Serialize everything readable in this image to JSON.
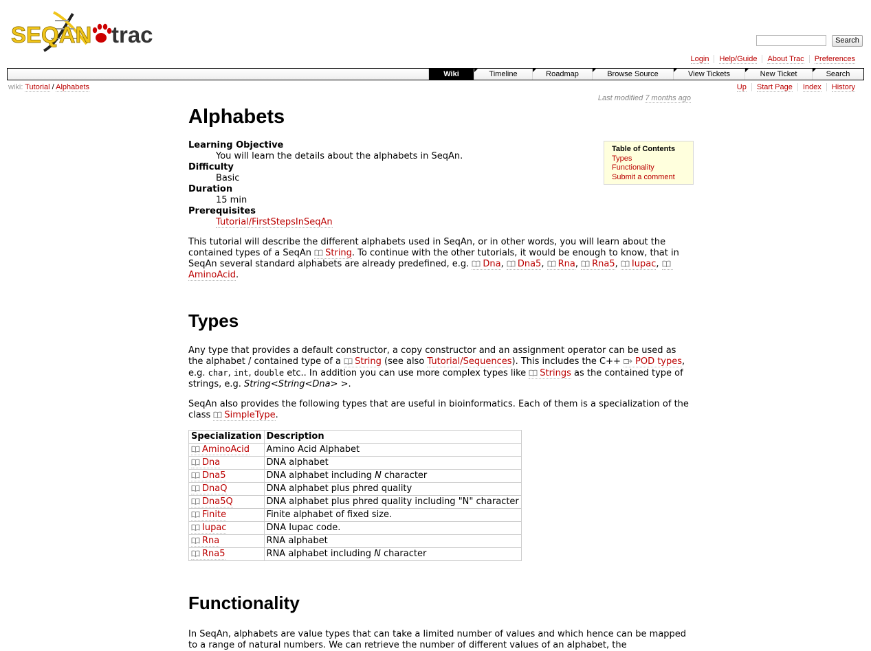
{
  "logo": {
    "seqan_text": "SEQAN",
    "trac_text": "trac",
    "colors": {
      "seqan": "#f0c419",
      "trac": "#333333",
      "paw": "#cc0000"
    }
  },
  "search": {
    "placeholder": "",
    "button_label": "Search"
  },
  "metanav": [
    "Login",
    "Help/Guide",
    "About Trac",
    "Preferences"
  ],
  "mainnav": [
    {
      "label": "Wiki",
      "active": true
    },
    {
      "label": "Timeline"
    },
    {
      "label": "Roadmap"
    },
    {
      "label": "Browse Source"
    },
    {
      "label": "View Tickets"
    },
    {
      "label": "New Ticket"
    },
    {
      "label": "Search"
    }
  ],
  "breadcrumb": {
    "prefix": "wiki:",
    "items": [
      "Tutorial",
      "Alphabets"
    ],
    "sep": "/"
  },
  "ctxtnav": [
    "Up",
    "Start Page",
    "Index",
    "History"
  ],
  "last_modified": {
    "prefix": "Last modified",
    "when": "7 months ago"
  },
  "page": {
    "title": "Alphabets",
    "meta": [
      {
        "term": "Learning Objective",
        "value": "You will learn the details about the alphabets in SeqAn."
      },
      {
        "term": "Difficulty",
        "value": "Basic"
      },
      {
        "term": "Duration",
        "value": "15 min"
      },
      {
        "term": "Prerequisites",
        "link": "Tutorial/FirstStepsInSeqAn"
      }
    ],
    "intro": {
      "t1": "This tutorial will describe the different alphabets used in SeqAn, or in other words, you will learn about the contained types of a SeqAn ",
      "l_string": "String",
      "t2": ". To continue with the other tutorials, it would be enough to know, that in SeqAn several standard alphabets are already predefined, e.g. ",
      "l_dna": "Dna",
      "l_dna5": "Dna5",
      "l_rna": "Rna",
      "l_rna5": "Rna5",
      "l_iupac": "Iupac",
      "l_aminoacid": "AminoAcid",
      "comma": ", ",
      "period": "."
    },
    "types_heading": "Types",
    "types_p1": {
      "t1": "Any type that provides a default constructor, a copy constructor and an assignment operator can be used as the alphabet / contained type of a ",
      "l_string": "String",
      "t2": " (see also ",
      "l_seq": "Tutorial/Sequences",
      "t3": "). This includes the C++ ",
      "l_pod": "POD types",
      "t4": ", e.g. ",
      "c_char": "char",
      "c_int": "int",
      "c_double": "double",
      "t5": " etc.. In addition you can use more complex types like ",
      "l_strings": "Strings",
      "t6": " as the contained type of strings, e.g. ",
      "em": "String<String<Dna> >",
      "t7": "."
    },
    "types_p2": {
      "t1": "SeqAn also provides the following types that are useful in bioinformatics. Each of them is a specialization of the class ",
      "l_simpletype": "SimpleType",
      "t2": "."
    },
    "table": {
      "headers": [
        "Specialization",
        "Description"
      ],
      "rows": [
        {
          "spec": "AminoAcid",
          "desc": "Amino Acid Alphabet"
        },
        {
          "spec": "Dna",
          "desc": "DNA alphabet"
        },
        {
          "spec": "Dna5",
          "desc_pre": "DNA alphabet including ",
          "desc_em": "N",
          "desc_post": " character"
        },
        {
          "spec": "DnaQ",
          "desc": "DNA alphabet plus phred quality"
        },
        {
          "spec": "Dna5Q",
          "desc": "DNA alphabet plus phred quality including \"N\" character"
        },
        {
          "spec": "Finite",
          "desc": "Finite alphabet of fixed size."
        },
        {
          "spec": "Iupac",
          "desc": "DNA Iupac code."
        },
        {
          "spec": "Rna",
          "desc": "RNA alphabet"
        },
        {
          "spec": "Rna5",
          "desc_pre": "RNA alphabet including ",
          "desc_em": "N",
          "desc_post": " character"
        }
      ]
    },
    "functionality_heading": "Functionality",
    "functionality_p": "In SeqAn, alphabets are value types that can take a limited number of values and which hence can be mapped to a range of natural numbers. We can retrieve the number of different values of an alphabet, the"
  },
  "toc": {
    "title": "Table of Contents",
    "items": [
      "Types",
      "Functionality",
      "Submit a comment"
    ]
  }
}
